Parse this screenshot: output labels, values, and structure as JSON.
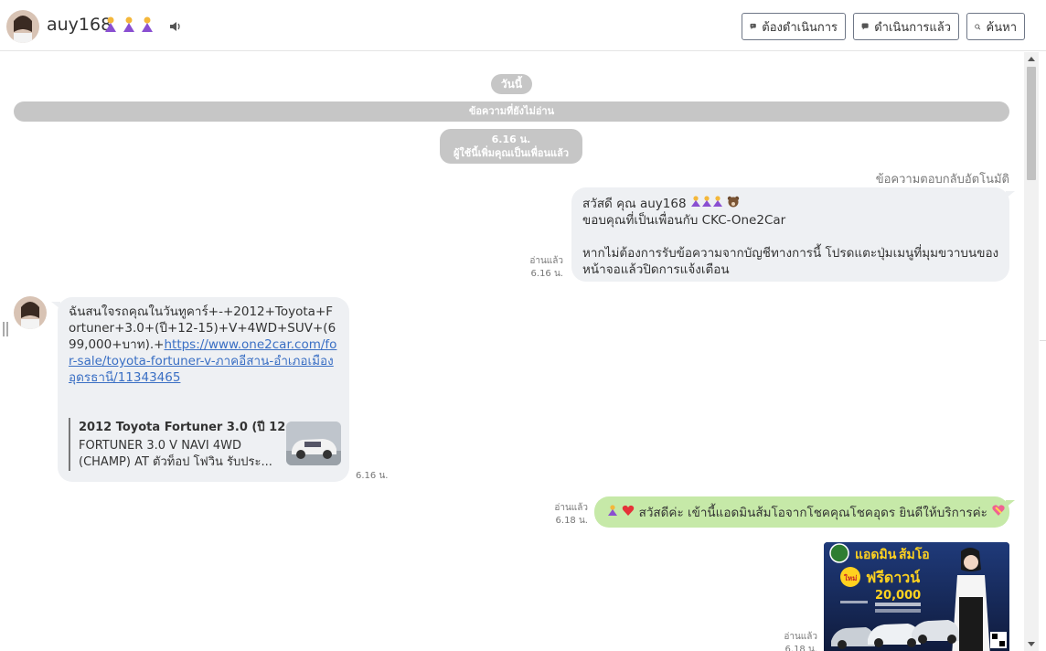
{
  "header": {
    "title": "auy168",
    "title_emojis": [
      "praying-icon",
      "praying-icon",
      "praying-icon"
    ],
    "buttons": {
      "todo": "ต้องดำเนินการ",
      "done": "ดำเนินการแล้ว",
      "search": "ค้นหา"
    }
  },
  "chat": {
    "date_pill": "วันนี้",
    "unread_bar": "ข้อความที่ยังไม่อ่าน",
    "system_notice": {
      "time": "6.16 น.",
      "text": "ผู้ใช้นี้เพิ่มคุณเป็นเพื่อนแล้ว"
    },
    "auto_reply_label": "ข้อความตอบกลับอัตโนมัติ",
    "messages": [
      {
        "side": "right",
        "line1": "สวัสดี คุณ auy168",
        "line2": "ขอบคุณที่เป็นเพื่อนกับ CKC-One2Car",
        "line3": "หากไม่ต้องการรับข้อความจากบัญชีทางการนี้ โปรดแตะปุ่มเมนูที่มุมขวาบนของ",
        "line4": "หน้าจอแล้วปิดการแจ้งเตือน",
        "read": "อ่านแล้ว",
        "time": "6.16 น."
      },
      {
        "side": "left",
        "text_plain": "ฉันสนใจรถคุณในวันทูคาร์+-+2012+Toyota+Fortuner+3.0+(ปี+12-15)+V+4WD+SUV+(699,000+บาท).+",
        "link": "https://www.one2car.com/for-sale/toyota-fortuner-v-ภาคอีสาน-อำเภอเมือง อุดรธานี/11343465",
        "preview_title": "2012 Toyota Fortuner 3.0 (ปี 12-...",
        "preview_desc": "FORTUNER 3.0 V NAVI 4WD (CHAMP) AT ตัวท็อป โฟวิน รับประ...",
        "time": "6.16 น."
      },
      {
        "side": "right",
        "text": "สวัสดีค่ะ เข้านี้แอดมินส้มโอจากโชคคุณโชคอุดร ยินดีให้บริการค่ะ",
        "read": "อ่านแล้ว",
        "time": "6.18 น."
      },
      {
        "side": "right",
        "type": "image",
        "image_text": "แอดมิน ส้มโอ ฟรีดาวน์ 20,000",
        "read": "อ่านแล้ว",
        "time": "6.18 น."
      }
    ]
  },
  "colors": {
    "bubble_gray": "#eef0f3",
    "bubble_green": "#c6e9a8",
    "pill_gray": "#c6c6c6",
    "link": "#3a6fc4"
  }
}
